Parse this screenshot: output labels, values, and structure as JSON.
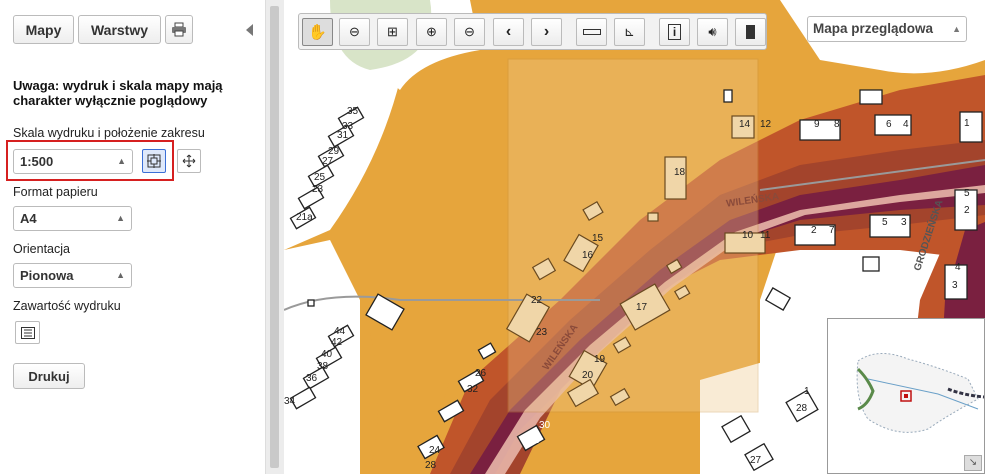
{
  "sidebar": {
    "tabs": {
      "maps": "Mapy",
      "layers": "Warstwy"
    },
    "notice": "Uwaga: wydruk i skala mapy mają charakter wyłącznie poglądowy",
    "scale_label": "Skala wydruku i położenie zakresu",
    "scale_value": "1:500",
    "paper_label": "Format papieru",
    "paper_value": "A4",
    "orientation_label": "Orientacja",
    "orientation_value": "Pionowa",
    "contents_label": "Zawartość wydruku",
    "print_button": "Drukuj"
  },
  "map": {
    "basemap_value": "Mapa przeglądowa",
    "street_labels": [
      "WILEŃSKA",
      "WILEŃSKA",
      "GRODZIEŃSKA"
    ],
    "house_numbers": [
      "35",
      "33",
      "31",
      "29",
      "27",
      "25",
      "23",
      "21a",
      "44",
      "42",
      "40",
      "38",
      "36",
      "34",
      "32",
      "26",
      "24",
      "28",
      "30",
      "21",
      "23",
      "22",
      "20",
      "19",
      "17",
      "15",
      "16",
      "18",
      "14",
      "12",
      "10",
      "11",
      "9",
      "8",
      "6",
      "4",
      "2",
      "7",
      "5",
      "3",
      "1",
      "2",
      "4",
      "5",
      "3",
      "1",
      "28",
      "27",
      "26"
    ],
    "toolbar_icons": [
      "hand-pan-icon",
      "zoom-out-box-icon",
      "full-extent-icon",
      "zoom-in-icon",
      "zoom-out-icon",
      "prev-extent-icon",
      "next-extent-icon",
      "measure-distance-icon",
      "measure-area-icon",
      "info-icon",
      "speaker-icon",
      "calculator-icon"
    ]
  },
  "colors": {
    "highlight": "#d62020",
    "road_dark": "#7a2040",
    "road_light": "#e8b6a8",
    "hazard_orange": "#e6a53c",
    "hazard_red": "#c0552a"
  }
}
